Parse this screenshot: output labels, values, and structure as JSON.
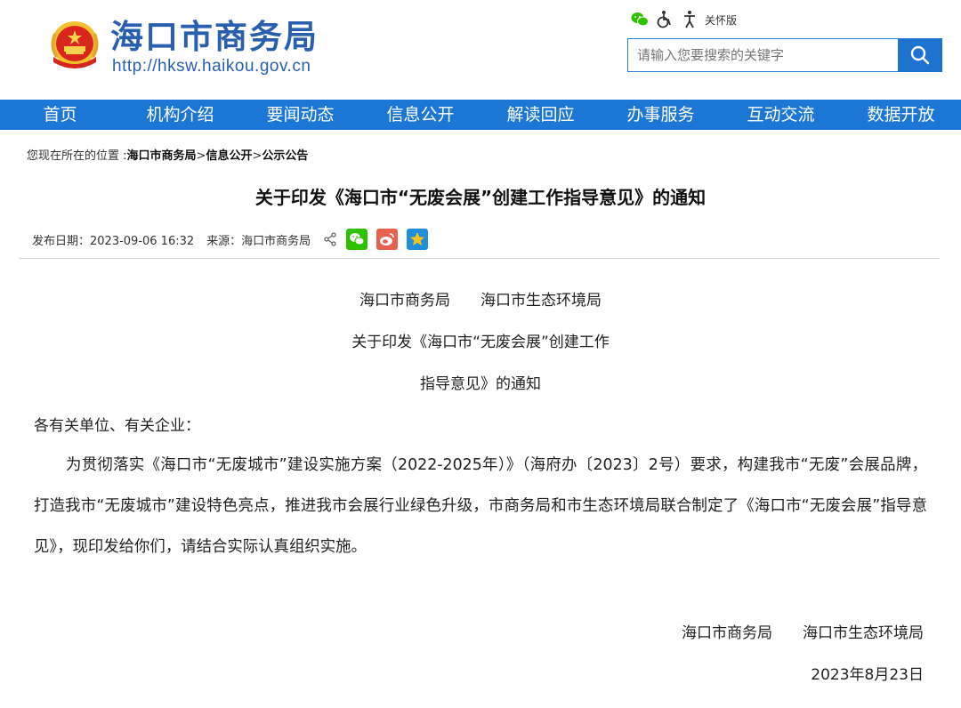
{
  "header": {
    "site_title": "海口市商务局",
    "site_url": "http://hksw.haikou.gov.cn",
    "care_label": "关怀版",
    "search_placeholder": "请输入您要搜索的关键字"
  },
  "nav": {
    "items": [
      {
        "label": "首页"
      },
      {
        "label": "机构介绍"
      },
      {
        "label": "要闻动态"
      },
      {
        "label": "信息公开"
      },
      {
        "label": "解读回应"
      },
      {
        "label": "办事服务"
      },
      {
        "label": "互动交流"
      },
      {
        "label": "数据开放"
      }
    ]
  },
  "breadcrumb": {
    "prefix": "您现在所在的位置 :",
    "items": [
      "海口市商务局",
      "信息公开",
      "公示公告"
    ],
    "separator": ">"
  },
  "article": {
    "title": "关于印发《海口市“无废会展”创建工作指导意见》的通知",
    "publish_date": "发布日期：2023-09-06 16:32",
    "source": "来源：海口市商务局",
    "issuers": "海口市商务局　　海口市生态环境局",
    "doc_title_line1": "关于印发《海口市“无废会展”创建工作",
    "doc_title_line2": "指导意见》的通知",
    "salutation": "各有关单位、有关企业：",
    "paragraph": "为贯彻落实《海口市“无废城市”建设实施方案（2022-2025年）》（海府办〔2023〕2号）要求，构建我市“无废”会展品牌，打造我市“无废城市”建设特色亮点，推进我市会展行业绿色升级，市商务局和市生态环境局联合制定了《海口市“无废会展”指导意见》，现印发给你们，请结合实际认真组织实施。",
    "signature": "海口市商务局　　海口市生态环境局",
    "date": "2023年8月23日"
  },
  "colors": {
    "brand_blue": "#2a5fb0",
    "nav_blue": "#1b76d6",
    "search_blue": "#1e73d1",
    "wechat_green": "#2dc100",
    "weibo_red": "#e6624f",
    "favorite_blue": "#1e8fd8"
  },
  "icons": {
    "emblem": "national-emblem-icon",
    "wechat": "wechat-icon",
    "accessibility": "accessibility-icon",
    "search": "search-icon",
    "share": "share-icon",
    "weibo": "weibo-icon",
    "favorite": "star-icon"
  }
}
